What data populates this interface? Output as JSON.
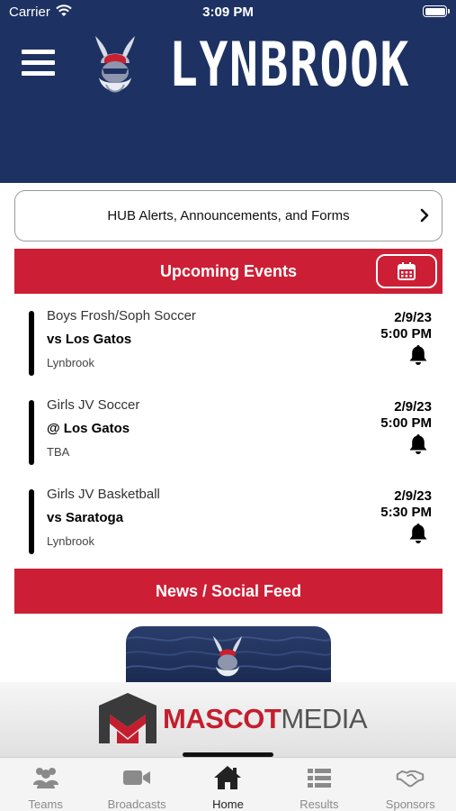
{
  "status_bar": {
    "carrier": "Carrier",
    "time": "3:09 PM"
  },
  "header": {
    "brand": "LYNBROOK",
    "menu_icon": "hamburger-menu-icon",
    "logo_icon": "viking-mascot-icon",
    "background_color": "#1d3262"
  },
  "hub_alerts": {
    "label": "HUB Alerts, Announcements, and Forms",
    "icon": "chevron-right-icon"
  },
  "upcoming_events": {
    "title": "Upcoming Events",
    "calendar_icon": "calendar-icon",
    "accent_color": "#cc1f35",
    "events": [
      {
        "sport": "Boys Frosh/Soph Soccer",
        "opponent": "vs Los Gatos",
        "location": "Lynbrook",
        "date": "2/9/23",
        "time": "5:00 PM"
      },
      {
        "sport": "Girls JV Soccer",
        "opponent": "@ Los Gatos",
        "location": "TBA",
        "date": "2/9/23",
        "time": "5:00 PM"
      },
      {
        "sport": "Girls JV Basketball",
        "opponent": "vs Saratoga",
        "location": "Lynbrook",
        "date": "2/9/23",
        "time": "5:30 PM"
      }
    ]
  },
  "news_feed": {
    "title": "News / Social Feed"
  },
  "sponsor": {
    "part1": "MASCOT",
    "part2": "MEDIA"
  },
  "tabs": [
    {
      "label": "Teams",
      "icon": "teams-icon",
      "active": false
    },
    {
      "label": "Broadcasts",
      "icon": "video-camera-icon",
      "active": false
    },
    {
      "label": "Home",
      "icon": "home-icon",
      "active": true
    },
    {
      "label": "Results",
      "icon": "list-icon",
      "active": false
    },
    {
      "label": "Sponsors",
      "icon": "handshake-icon",
      "active": false
    }
  ]
}
